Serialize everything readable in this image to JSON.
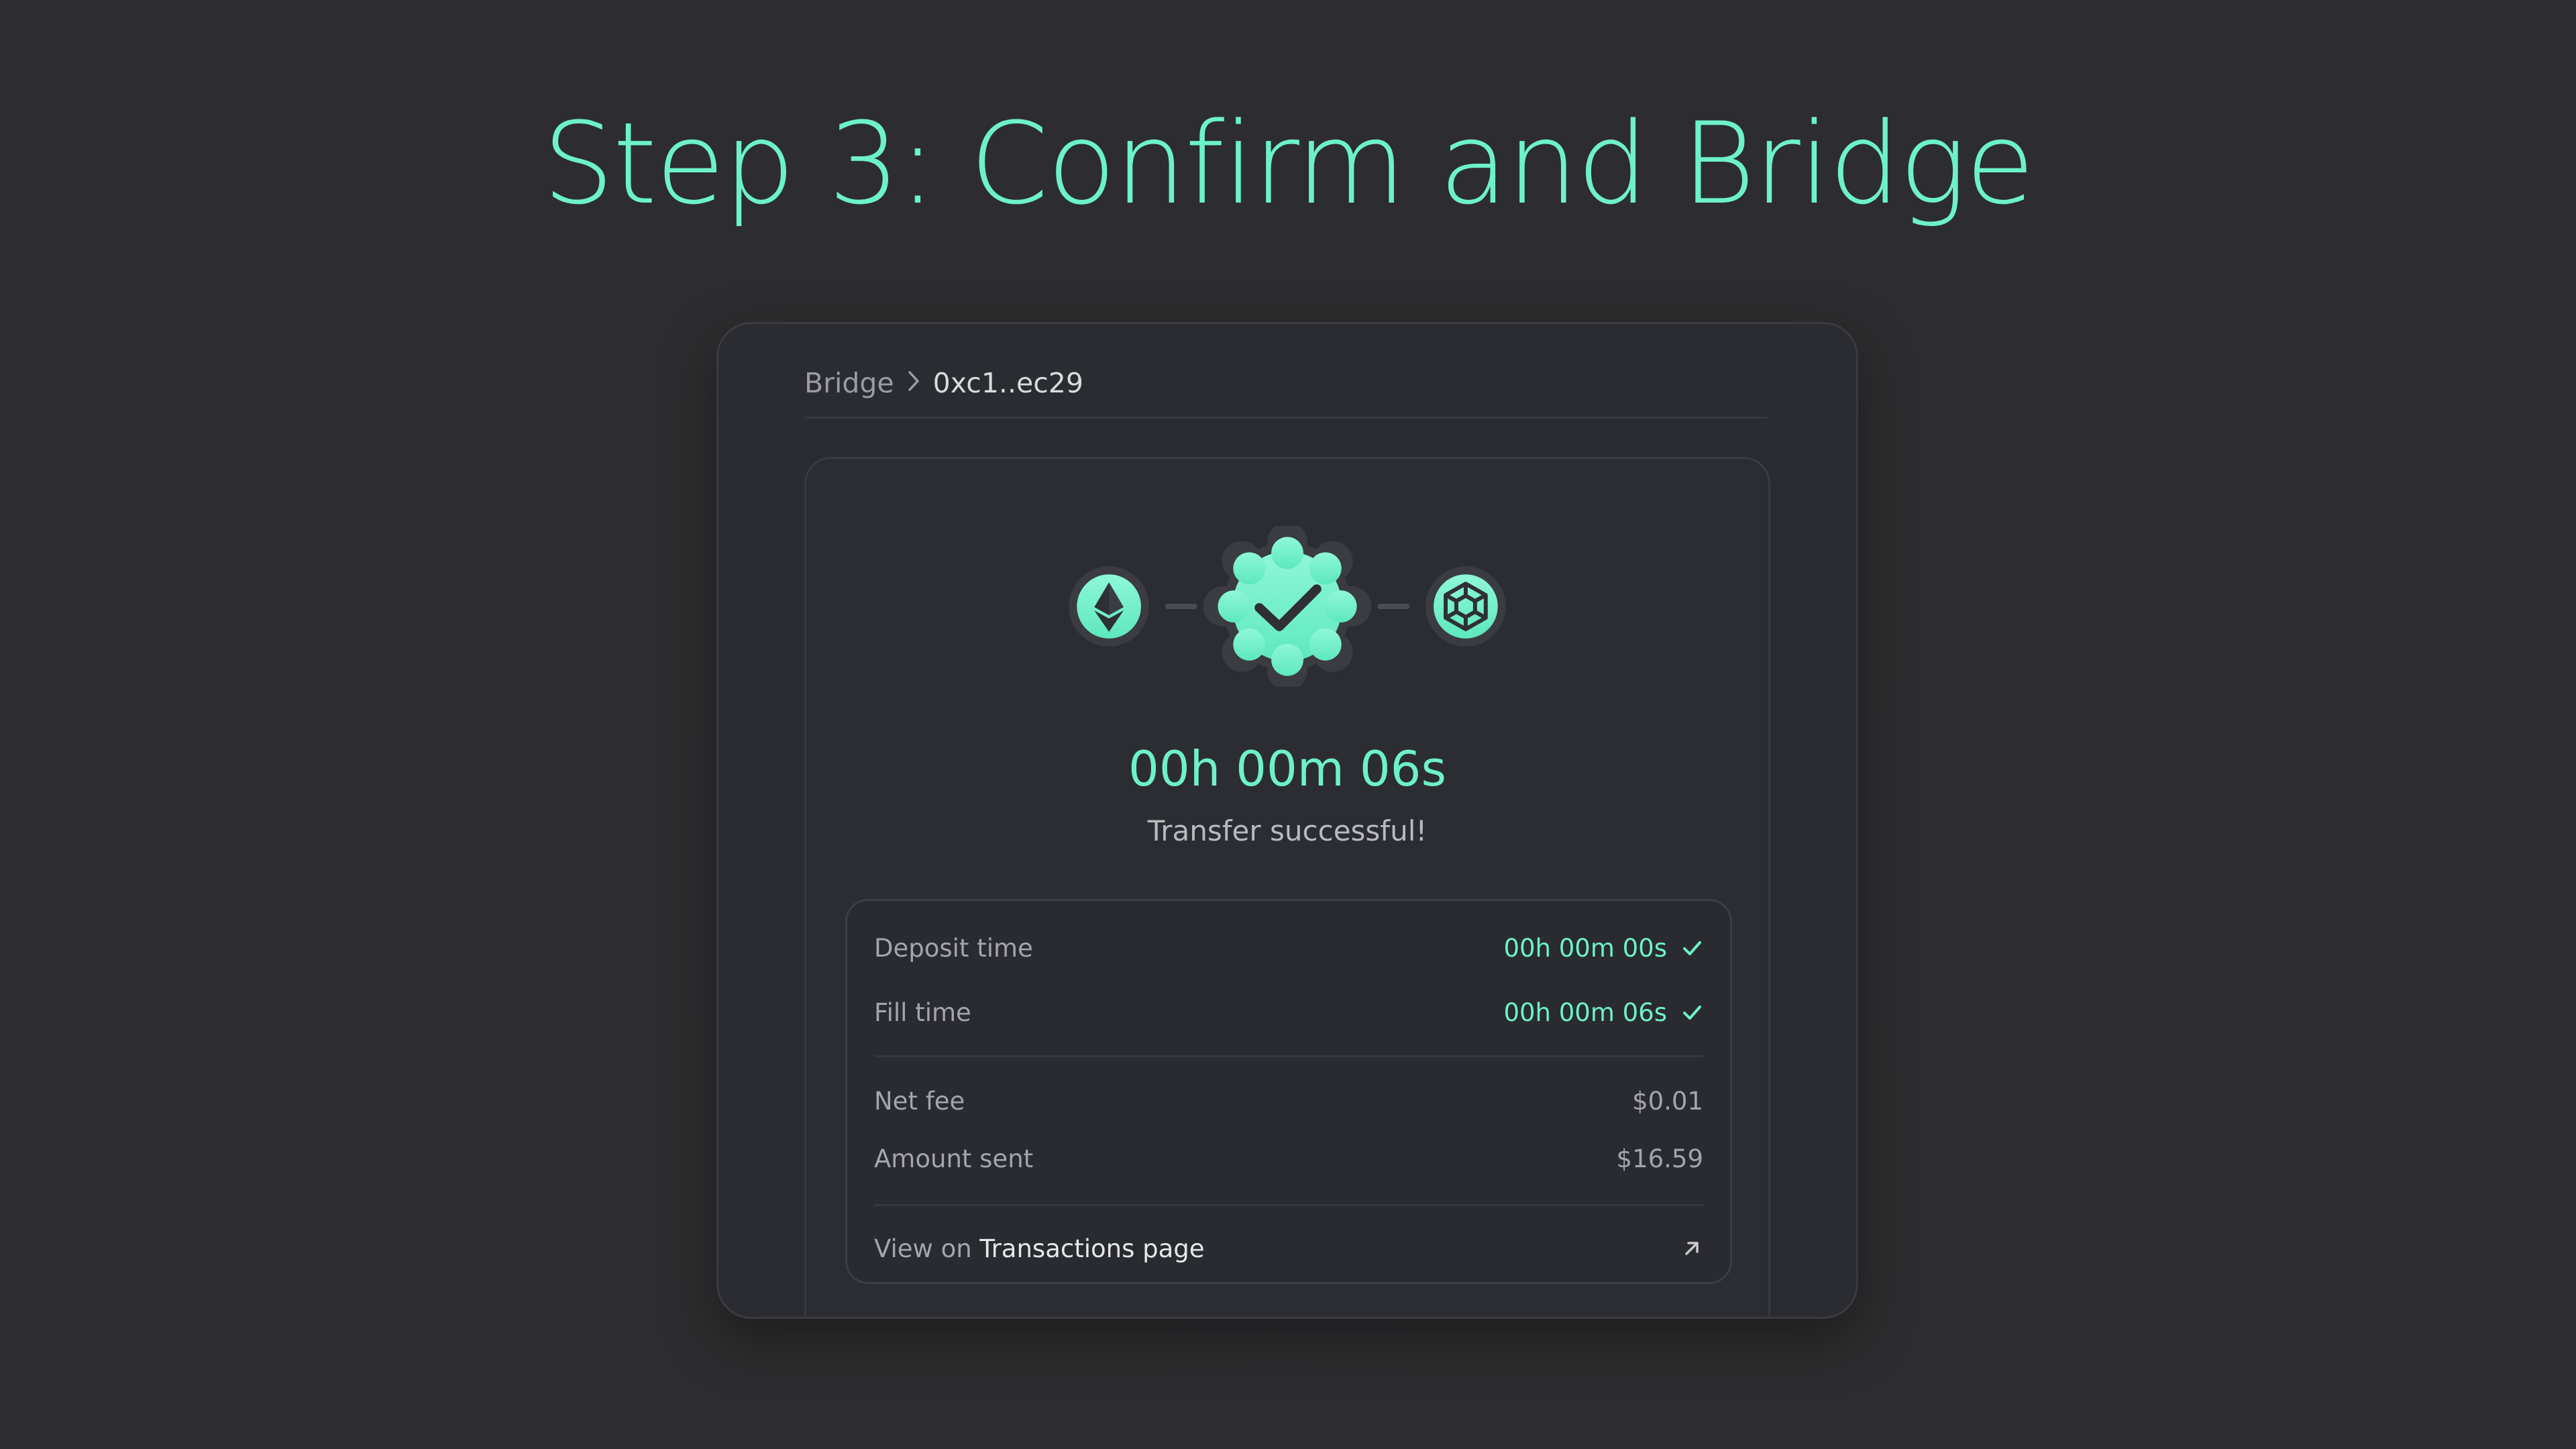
{
  "headline": "Step 3: Confirm and Bridge",
  "breadcrumb": {
    "root": "Bridge",
    "separator_icon": "chevron-right-icon",
    "current": "0xc1..ec29"
  },
  "route": {
    "from_chain_icon": "ethereum-icon",
    "status_icon": "check-badge-icon",
    "to_chain_icon": "bnb-chain-icon"
  },
  "timer": "00h 00m 06s",
  "status": "Transfer successful!",
  "details": {
    "deposit_time": {
      "label": "Deposit time",
      "value": "00h 00m 00s",
      "icon": "check-icon"
    },
    "fill_time": {
      "label": "Fill time",
      "value": "00h 00m 06s",
      "icon": "check-icon"
    },
    "net_fee": {
      "label": "Net fee",
      "value": "$0.01"
    },
    "amount_sent": {
      "label": "Amount sent",
      "value": "$16.59"
    },
    "link": {
      "prefix": "View on",
      "text": "Transactions page",
      "icon": "external-link-arrow-icon"
    }
  },
  "colors": {
    "accent": "#6df2c7",
    "background": "#2d2d2f",
    "card": "#2b2c31",
    "text_muted": "#a4a5ab"
  }
}
